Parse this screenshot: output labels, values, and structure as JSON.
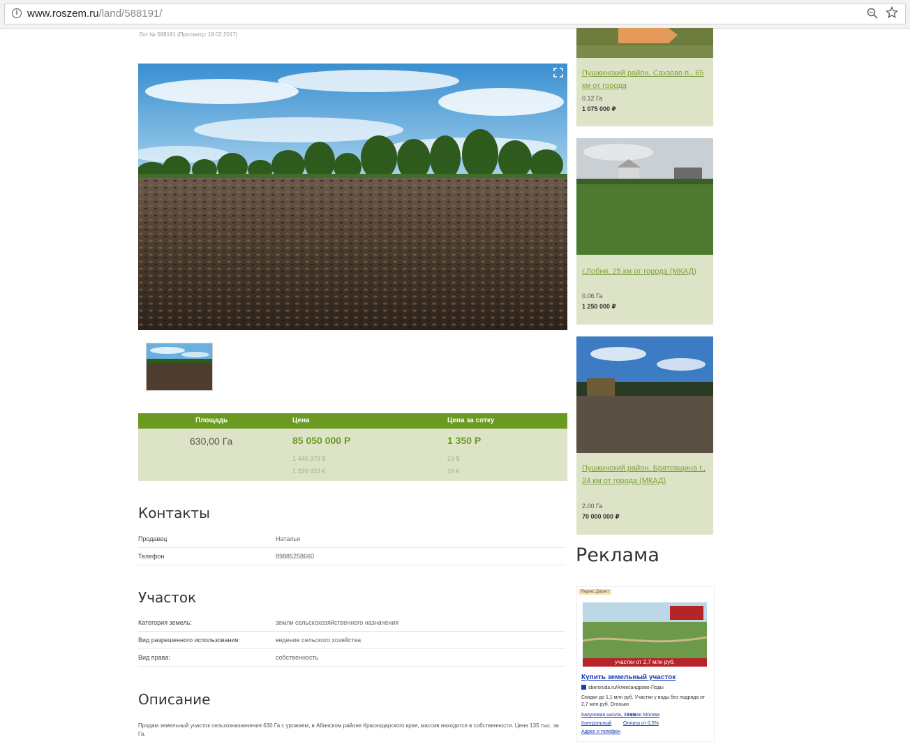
{
  "browser": {
    "url_host": "www.roszem.ru",
    "url_path": "/land/588191/"
  },
  "listing": {
    "subtitle": "Лот № 588191 (Просмотр: 19.02.2017)",
    "price_table": {
      "headers": [
        "Площадь",
        "Цена",
        "Цена за сотку"
      ],
      "area": "630,00 Га",
      "price": "85 050 000 Р",
      "price_usd": "1 440 379 $",
      "price_eur": "1 220 453 €",
      "price_per_sotka": "1 350 Р",
      "per_sotka_usd": "23 $",
      "per_sotka_eur": "19 €"
    },
    "contacts": {
      "title": "Контакты",
      "rows": [
        {
          "label": "Продавец",
          "value": "Наталья"
        },
        {
          "label": "Телефон",
          "value": "89885258660"
        }
      ]
    },
    "plot": {
      "title": "Участок",
      "rows": [
        {
          "label": "Категория земель:",
          "value": "земли сельскохозяйственного назначения"
        },
        {
          "label": "Вид разрешенного использования:",
          "value": "ведение сельского хозяйства"
        },
        {
          "label": "Вид права:",
          "value": "собственность"
        }
      ]
    },
    "description": {
      "title": "Описание",
      "text": "Продам земельный участок сельхозназначения 630 Га с урожаем, в Абинском районе Краснодарского края, массив находится в собственности. Цена 135 тыс. за Га."
    }
  },
  "sidebar": {
    "cards": [
      {
        "link": "Пушкинский район, Сахзово п., 65 км от города",
        "area": "0.12 Га",
        "price": "1 075 000 ₽"
      },
      {
        "link": "г.Лобня, 25 км от города (МКАД)",
        "area": "0.06 Га",
        "price": "1 250 000 ₽"
      },
      {
        "link": "Пушкинский район, Братовщина г., 24 км от города (МКАД)",
        "area": "2.00 Га",
        "price": "70 000 000 ₽"
      }
    ],
    "ads_title": "Реклама",
    "ad": {
      "label": "Яндекс.Директ",
      "banner_text": "участки от 2,7 млн руб.",
      "title": "Купить земельный участок",
      "domain": "sbersruda.ru/Александрово-Поды",
      "text": "Скидки до 1,1 млн руб. Участки у воды без подряда от 2,7 млн руб. Огоньки",
      "links": [
        "Капуновая школа, 30 км",
        "Новая Москва",
        "Контрольный",
        "Оплата от 0,5%",
        "Адрес и телефон"
      ]
    }
  },
  "colors": {
    "accent_green": "#6a9a1f",
    "panel_bg": "#dde3c7",
    "link_green": "#7fa23a",
    "ad_link_blue": "#1a3bb3"
  }
}
